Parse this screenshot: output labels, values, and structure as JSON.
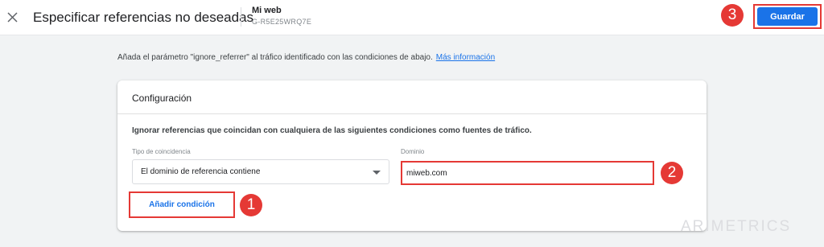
{
  "header": {
    "title": "Especificar referencias no deseadas",
    "property_name": "Mi web",
    "property_id": "G-R5E25WRQ7E",
    "save_label": "Guardar"
  },
  "intro": {
    "text": "Añada el parámetro \"ignore_referrer\" al tráfico identificado con las condiciones de abajo.",
    "link": "Más información"
  },
  "card": {
    "title": "Configuración",
    "description": "Ignorar referencias que coincidan con cualquiera de las siguientes condiciones como fuentes de tráfico.",
    "match_type_label": "Tipo de coincidencia",
    "match_type_value": "El dominio de referencia contiene",
    "domain_label": "Dominio",
    "domain_value": "miweb.com",
    "add_condition_label": "Añadir condición"
  },
  "annotations": {
    "step1": "1",
    "step2": "2",
    "step3": "3"
  },
  "watermark": "ARIMETRICS",
  "colors": {
    "accent": "#1a73e8",
    "annotation": "#e53935"
  },
  "icons": {
    "close": "close-icon",
    "dropdown": "caret-down-icon"
  }
}
